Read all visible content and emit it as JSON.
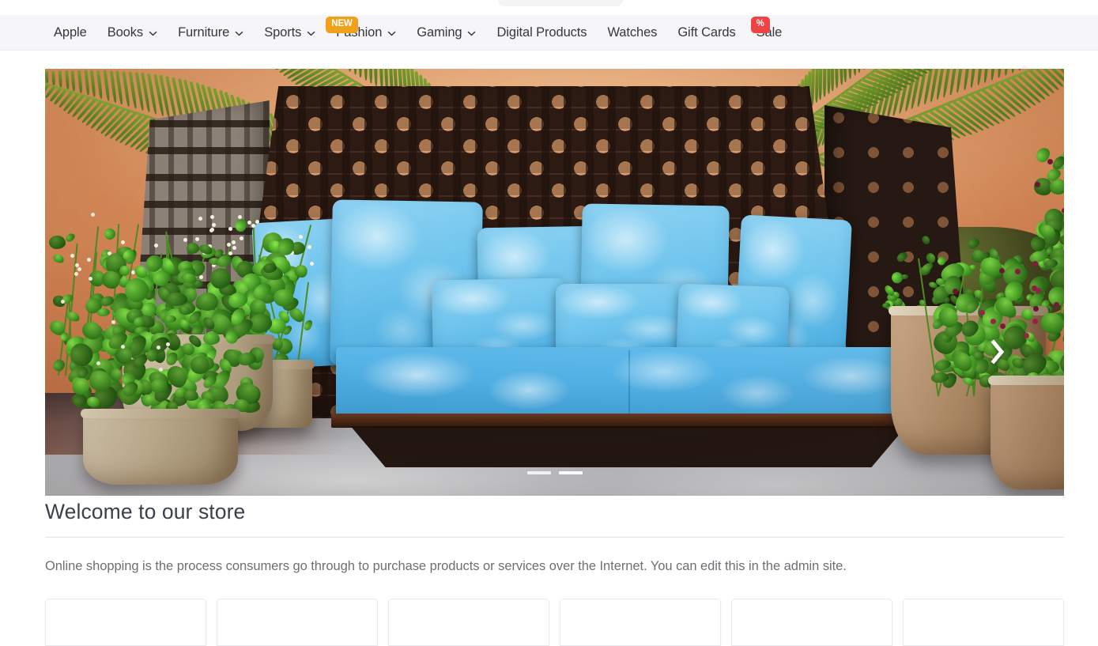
{
  "page": {
    "background_color": "#ffffff"
  },
  "topnav": {
    "background_color": "#f6f6f8",
    "items": [
      {
        "label": "Apple",
        "has_dropdown": false,
        "badge": null
      },
      {
        "label": "Books",
        "has_dropdown": true,
        "badge": null
      },
      {
        "label": "Furniture",
        "has_dropdown": true,
        "badge": null
      },
      {
        "label": "Sports",
        "has_dropdown": true,
        "badge": null
      },
      {
        "label": "Fashion",
        "has_dropdown": true,
        "badge": {
          "text": "NEW",
          "color": "#f0a019"
        }
      },
      {
        "label": "Gaming",
        "has_dropdown": true,
        "badge": null
      },
      {
        "label": "Digital Products",
        "has_dropdown": false,
        "badge": null
      },
      {
        "label": "Watches",
        "has_dropdown": false,
        "badge": null
      },
      {
        "label": "Gift Cards",
        "has_dropdown": false,
        "badge": null
      },
      {
        "label": "Sale",
        "has_dropdown": false,
        "badge": {
          "text": "%",
          "color": "#ef4444"
        }
      }
    ]
  },
  "hero": {
    "alt": "outdoor-patio-daybed-banner",
    "scene_description": "Woven high-back outdoor daybed with light blue cushions and pillows against a terracotta wall, flanked by potted plants on a diamond-tiled patio",
    "next_arrow_icon": "chevron-right-icon",
    "slide_count": 2,
    "active_slide": 1,
    "colors": {
      "wall": "#d28555",
      "cushion": "#56b3e6",
      "weave_dark": "#3a2318",
      "tile_light": "#e8eaee",
      "tile_dark": "#5d6470"
    }
  },
  "welcome": {
    "title": "Welcome to our store",
    "text": "Online shopping is the process consumers go through to purchase products or services over the Internet. You can edit this in the admin site."
  },
  "featured": {
    "cards": [
      {
        "id": "card-1"
      },
      {
        "id": "card-2"
      },
      {
        "id": "card-3"
      },
      {
        "id": "card-4"
      },
      {
        "id": "card-5"
      },
      {
        "id": "card-6"
      }
    ]
  }
}
